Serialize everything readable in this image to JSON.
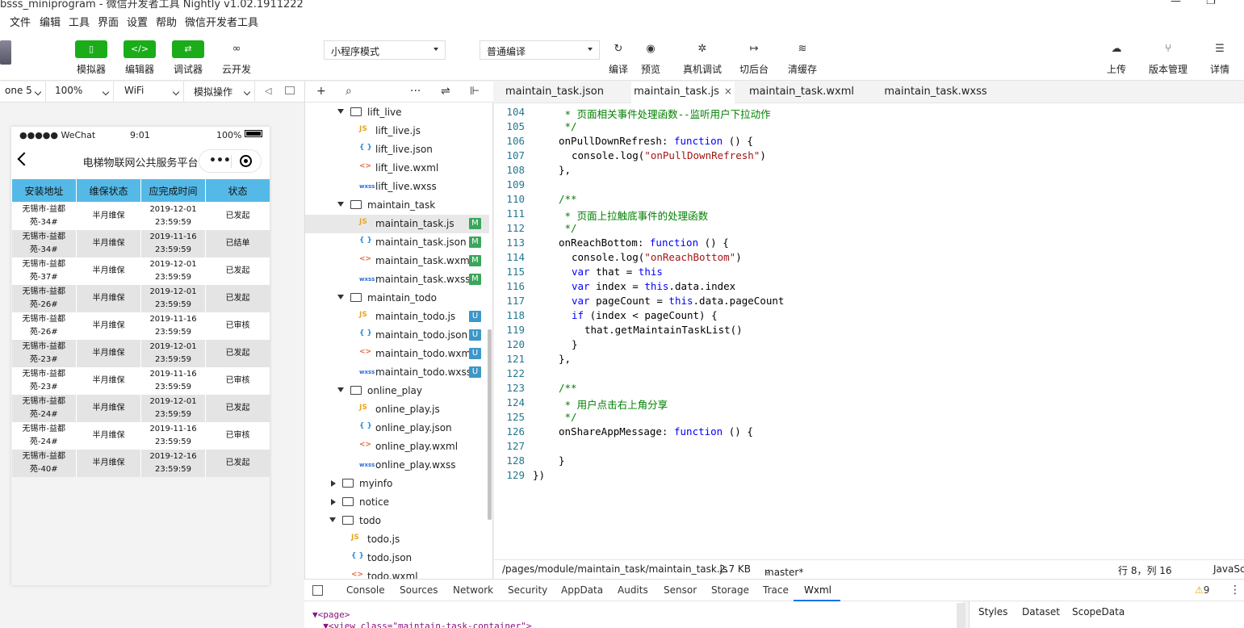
{
  "window": {
    "title": "bsss_miniprogram - 微信开发者工具 Nightly v1.02.1911222",
    "minimize_glyph": "—",
    "restore_glyph": "❐"
  },
  "menu": [
    "文件",
    "编辑",
    "工具",
    "界面",
    "设置",
    "帮助",
    "微信开发者工具"
  ],
  "toolbar": {
    "left_buttons": [
      {
        "label": "模拟器",
        "icon": "phone-icon",
        "glyph": "▯"
      },
      {
        "label": "编辑器",
        "icon": "code-icon",
        "glyph": "</>"
      },
      {
        "label": "调试器",
        "icon": "debugger-icon",
        "glyph": "⇄"
      },
      {
        "label": "云开发",
        "icon": "cloud-link-icon",
        "glyph": "∞"
      }
    ],
    "mode_select": "小程序模式",
    "compile_select": "普通编译",
    "center_buttons": [
      {
        "label": "编译",
        "icon": "refresh-icon",
        "glyph": "↻"
      },
      {
        "label": "预览",
        "icon": "eye-icon",
        "glyph": "◉"
      },
      {
        "label": "真机调试",
        "icon": "bug-icon",
        "glyph": "✲"
      },
      {
        "label": "切后台",
        "icon": "switch-background-icon",
        "glyph": "↦"
      },
      {
        "label": "清缓存",
        "icon": "layers-icon",
        "glyph": "≋"
      }
    ],
    "right_buttons": [
      {
        "label": "上传",
        "icon": "upload-cloud-icon",
        "glyph": "☁"
      },
      {
        "label": "版本管理",
        "icon": "branch-icon",
        "glyph": "⑂"
      },
      {
        "label": "详情",
        "icon": "menu-icon",
        "glyph": "☰"
      }
    ],
    "accent_color": "#1aad19"
  },
  "simulator": {
    "device": "one 5",
    "zoom": "100%",
    "network": "WiFi",
    "operation": "模拟操作",
    "status": {
      "carrier": "●●●●● WeChat",
      "time": "9:01",
      "battery": "100%"
    },
    "nav_title": "电梯物联网公共服务平台",
    "headers": [
      "安装地址",
      "维保状态",
      "应完成时间",
      "状态"
    ],
    "rows": [
      {
        "addr": [
          "无锡市-益都",
          "苑-34#"
        ],
        "type": "半月维保",
        "date": "2019-12-01",
        "time": "23:59:59",
        "status": "已发起"
      },
      {
        "addr": [
          "无锡市-益都",
          "苑-34#"
        ],
        "type": "半月维保",
        "date": "2019-11-16",
        "time": "23:59:59",
        "status": "已结单"
      },
      {
        "addr": [
          "无锡市-益都",
          "苑-37#"
        ],
        "type": "半月维保",
        "date": "2019-12-01",
        "time": "23:59:59",
        "status": "已发起"
      },
      {
        "addr": [
          "无锡市-益都",
          "苑-26#"
        ],
        "type": "半月维保",
        "date": "2019-12-01",
        "time": "23:59:59",
        "status": "已发起"
      },
      {
        "addr": [
          "无锡市-益都",
          "苑-26#"
        ],
        "type": "半月维保",
        "date": "2019-11-16",
        "time": "23:59:59",
        "status": "已审核"
      },
      {
        "addr": [
          "无锡市-益都",
          "苑-23#"
        ],
        "type": "半月维保",
        "date": "2019-12-01",
        "time": "23:59:59",
        "status": "已发起"
      },
      {
        "addr": [
          "无锡市-益都",
          "苑-23#"
        ],
        "type": "半月维保",
        "date": "2019-11-16",
        "time": "23:59:59",
        "status": "已审核"
      },
      {
        "addr": [
          "无锡市-益都",
          "苑-24#"
        ],
        "type": "半月维保",
        "date": "2019-12-01",
        "time": "23:59:59",
        "status": "已发起"
      },
      {
        "addr": [
          "无锡市-益都",
          "苑-24#"
        ],
        "type": "半月维保",
        "date": "2019-11-16",
        "time": "23:59:59",
        "status": "已审核"
      },
      {
        "addr": [
          "无锡市-益都",
          "苑-40#"
        ],
        "type": "半月维保",
        "date": "2019-12-16",
        "time": "23:59:59",
        "status": "已发起"
      }
    ],
    "header_color": "#54b9e7"
  },
  "tree": {
    "toolbar_glyphs": [
      "+",
      "⌕",
      "···",
      "⇌",
      "⊩"
    ],
    "items": [
      {
        "kind": "folder",
        "name": "lift_live",
        "level": 1,
        "open": true
      },
      {
        "kind": "js",
        "name": "lift_live.js",
        "level": 2
      },
      {
        "kind": "json",
        "name": "lift_live.json",
        "level": 2
      },
      {
        "kind": "wxml",
        "name": "lift_live.wxml",
        "level": 2
      },
      {
        "kind": "wxss",
        "name": "lift_live.wxss",
        "level": 2
      },
      {
        "kind": "folder",
        "name": "maintain_task",
        "level": 1,
        "open": true
      },
      {
        "kind": "js",
        "name": "maintain_task.js",
        "level": 2,
        "badge": "M",
        "selected": true
      },
      {
        "kind": "json",
        "name": "maintain_task.json",
        "level": 2,
        "badge": "M"
      },
      {
        "kind": "wxml",
        "name": "maintain_task.wxml",
        "level": 2,
        "badge": "M"
      },
      {
        "kind": "wxss",
        "name": "maintain_task.wxss",
        "level": 2,
        "badge": "M"
      },
      {
        "kind": "folder",
        "name": "maintain_todo",
        "level": 1,
        "open": true
      },
      {
        "kind": "js",
        "name": "maintain_todo.js",
        "level": 2,
        "badge": "U"
      },
      {
        "kind": "json",
        "name": "maintain_todo.json",
        "level": 2,
        "badge": "U"
      },
      {
        "kind": "wxml",
        "name": "maintain_todo.wxml",
        "level": 2,
        "badge": "U"
      },
      {
        "kind": "wxss",
        "name": "maintain_todo.wxss",
        "level": 2,
        "badge": "U"
      },
      {
        "kind": "folder",
        "name": "online_play",
        "level": 1,
        "open": true
      },
      {
        "kind": "js",
        "name": "online_play.js",
        "level": 2
      },
      {
        "kind": "json",
        "name": "online_play.json",
        "level": 2
      },
      {
        "kind": "wxml",
        "name": "online_play.wxml",
        "level": 2
      },
      {
        "kind": "wxss",
        "name": "online_play.wxss",
        "level": 2
      },
      {
        "kind": "folder",
        "name": "myinfo",
        "level": 0,
        "open": false
      },
      {
        "kind": "folder",
        "name": "notice",
        "level": 0,
        "open": false
      },
      {
        "kind": "folder",
        "name": "todo",
        "level": 0,
        "open": true
      },
      {
        "kind": "js",
        "name": "todo.js",
        "level": 1
      },
      {
        "kind": "json",
        "name": "todo.json",
        "level": 1
      },
      {
        "kind": "wxml",
        "name": "todo.wxml",
        "level": 1
      }
    ],
    "badge_colors": {
      "M": "#3aa65a",
      "U": "#3d97c9"
    }
  },
  "editor": {
    "tabs": [
      {
        "label": "maintain_task.json",
        "active": false
      },
      {
        "label": "maintain_task.js",
        "active": true
      },
      {
        "label": "maintain_task.wxml",
        "active": false
      },
      {
        "label": "maintain_task.wxss",
        "active": false
      }
    ],
    "close_glyph": "×",
    "lines": [
      {
        "n": 104,
        "indent": 1,
        "parts": [
          [
            "c",
            " * 页面相关事件处理函数--监听用户下拉动作"
          ]
        ]
      },
      {
        "n": 105,
        "indent": 1,
        "parts": [
          [
            "c",
            " */"
          ]
        ]
      },
      {
        "n": 106,
        "indent": 1,
        "parts": [
          [
            "t",
            "onPullDownRefresh: "
          ],
          [
            "k",
            "function"
          ],
          [
            "t",
            " () {"
          ]
        ]
      },
      {
        "n": 107,
        "indent": 2,
        "parts": [
          [
            "t",
            "console.log("
          ],
          [
            "s",
            "\"onPullDownRefresh\""
          ],
          [
            "t",
            ")"
          ]
        ]
      },
      {
        "n": 108,
        "indent": 1,
        "parts": [
          [
            "t",
            "},"
          ]
        ]
      },
      {
        "n": 109,
        "indent": 0,
        "parts": []
      },
      {
        "n": 110,
        "indent": 1,
        "parts": [
          [
            "c",
            "/**"
          ]
        ]
      },
      {
        "n": 111,
        "indent": 1,
        "parts": [
          [
            "c",
            " * 页面上拉触底事件的处理函数"
          ]
        ]
      },
      {
        "n": 112,
        "indent": 1,
        "parts": [
          [
            "c",
            " */"
          ]
        ]
      },
      {
        "n": 113,
        "indent": 1,
        "parts": [
          [
            "t",
            "onReachBottom: "
          ],
          [
            "k",
            "function"
          ],
          [
            "t",
            " () {"
          ]
        ]
      },
      {
        "n": 114,
        "indent": 2,
        "parts": [
          [
            "t",
            "console.log("
          ],
          [
            "s",
            "\"onReachBottom\""
          ],
          [
            "t",
            ")"
          ]
        ]
      },
      {
        "n": 115,
        "indent": 2,
        "parts": [
          [
            "k",
            "var"
          ],
          [
            "t",
            " that = "
          ],
          [
            "k",
            "this"
          ]
        ]
      },
      {
        "n": 116,
        "indent": 2,
        "parts": [
          [
            "k",
            "var"
          ],
          [
            "t",
            " index = "
          ],
          [
            "k",
            "this"
          ],
          [
            "t",
            ".data.index"
          ]
        ]
      },
      {
        "n": 117,
        "indent": 2,
        "parts": [
          [
            "k",
            "var"
          ],
          [
            "t",
            " pageCount = "
          ],
          [
            "k",
            "this"
          ],
          [
            "t",
            ".data.pageCount"
          ]
        ]
      },
      {
        "n": 118,
        "indent": 2,
        "parts": [
          [
            "k",
            "if"
          ],
          [
            "t",
            " (index < pageCount) {"
          ]
        ]
      },
      {
        "n": 119,
        "indent": 3,
        "parts": [
          [
            "t",
            "that.getMaintainTaskList()"
          ]
        ]
      },
      {
        "n": 120,
        "indent": 2,
        "parts": [
          [
            "t",
            "}"
          ]
        ]
      },
      {
        "n": 121,
        "indent": 1,
        "parts": [
          [
            "t",
            "},"
          ]
        ]
      },
      {
        "n": 122,
        "indent": 0,
        "parts": []
      },
      {
        "n": 123,
        "indent": 1,
        "parts": [
          [
            "c",
            "/**"
          ]
        ]
      },
      {
        "n": 124,
        "indent": 1,
        "parts": [
          [
            "c",
            " * 用户点击右上角分享"
          ]
        ]
      },
      {
        "n": 125,
        "indent": 1,
        "parts": [
          [
            "c",
            " */"
          ]
        ]
      },
      {
        "n": 126,
        "indent": 1,
        "parts": [
          [
            "t",
            "onShareAppMessage: "
          ],
          [
            "k",
            "function"
          ],
          [
            "t",
            " () {"
          ]
        ]
      },
      {
        "n": 127,
        "indent": 0,
        "parts": []
      },
      {
        "n": 128,
        "indent": 1,
        "parts": [
          [
            "t",
            "}"
          ]
        ]
      },
      {
        "n": 129,
        "indent": 0,
        "parts": [
          [
            "t",
            "})"
          ]
        ]
      }
    ],
    "syntax_colors": {
      "keyword": "#0000ff",
      "string": "#a31515",
      "comment": "#008000",
      "line_number": "#237893"
    }
  },
  "status_bar": {
    "path": "/pages/module/maintain_task/maintain_task.js",
    "size": "2.7 KB",
    "branch": "master*",
    "position": "行 8，列 16",
    "language": "JavaScript"
  },
  "devtools": {
    "tabs": [
      "Console",
      "Sources",
      "Network",
      "Security",
      "AppData",
      "Audits",
      "Sensor",
      "Storage",
      "Trace",
      "Wxml"
    ],
    "active_tab": "Wxml",
    "warnings": "9",
    "code_lines": [
      "▼<page>",
      "  ▼<view class=\"maintain-task-container\">"
    ],
    "side_tabs": [
      "Styles",
      "Dataset",
      "ScopeData"
    ]
  }
}
